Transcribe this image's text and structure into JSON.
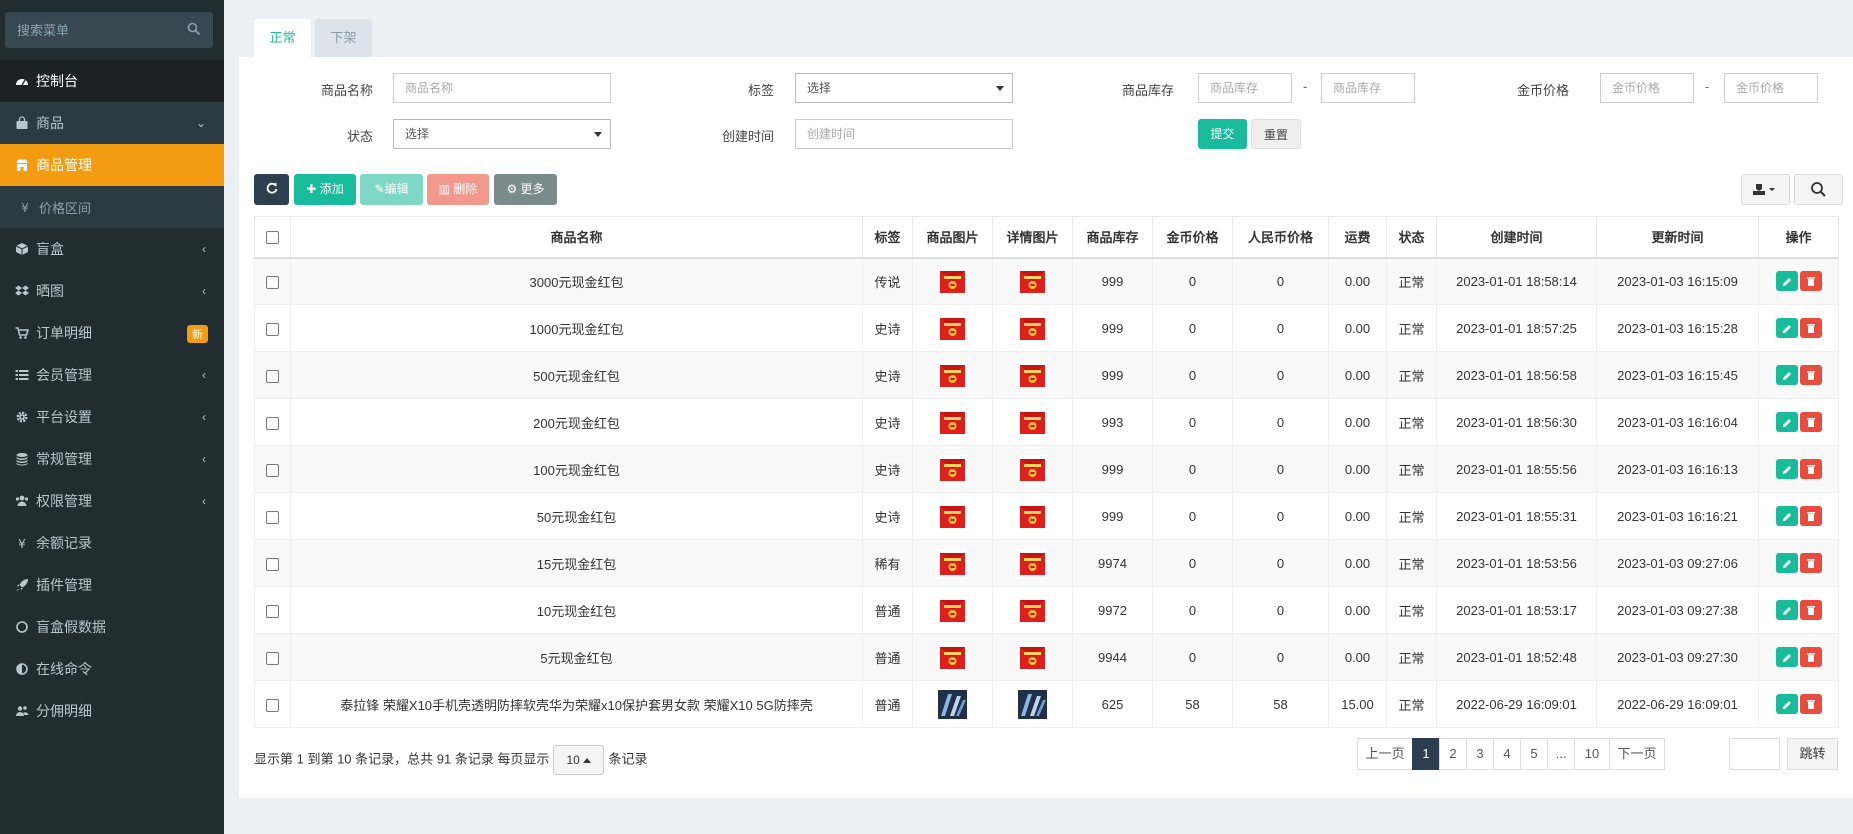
{
  "sidebar": {
    "search_placeholder": "搜索菜单",
    "items": [
      {
        "label": "控制台",
        "icon": "dashboard-icon"
      },
      {
        "label": "商品",
        "icon": "shopping-bag-icon"
      },
      {
        "label": "商品管理",
        "icon": "shop-icon"
      },
      {
        "label": "价格区间",
        "icon": "yen-icon"
      },
      {
        "label": "盲盒",
        "icon": "cube-icon"
      },
      {
        "label": "晒图",
        "icon": "dropbox-icon"
      },
      {
        "label": "订单明细",
        "icon": "cart-icon",
        "badge": "新"
      },
      {
        "label": "会员管理",
        "icon": "list-icon"
      },
      {
        "label": "平台设置",
        "icon": "cog-icon"
      },
      {
        "label": "常规管理",
        "icon": "database-icon"
      },
      {
        "label": "权限管理",
        "icon": "group-icon"
      },
      {
        "label": "余额记录",
        "icon": "yen-icon"
      },
      {
        "label": "插件管理",
        "icon": "rocket-icon"
      },
      {
        "label": "盲盒假数据",
        "icon": "circle-icon"
      },
      {
        "label": "在线命令",
        "icon": "adjust-icon"
      },
      {
        "label": "分佣明细",
        "icon": "users-icon"
      }
    ]
  },
  "tabs": [
    "正常",
    "下架"
  ],
  "filters": {
    "name_label": "商品名称",
    "name_placeholder": "商品名称",
    "tag_label": "标签",
    "tag_value": "选择",
    "stock_label": "商品库存",
    "stock_min_placeholder": "商品库存",
    "stock_max_placeholder": "商品库存",
    "price_label": "金币价格",
    "price_min_placeholder": "金币价格",
    "price_max_placeholder": "金币价格",
    "status_label": "状态",
    "status_value": "选择",
    "created_label": "创建时间",
    "created_placeholder": "创建时间",
    "dash": "-",
    "submit": "提交",
    "reset": "重置"
  },
  "toolbar": {
    "add": "添加",
    "edit": "编辑",
    "delete": "删除",
    "more": "更多"
  },
  "table": {
    "headers": [
      "商品名称",
      "标签",
      "商品图片",
      "详情图片",
      "商品库存",
      "金币价格",
      "人民币价格",
      "运费",
      "状态",
      "创建时间",
      "更新时间",
      "操作"
    ],
    "rows": [
      {
        "name": "3000元现金红包",
        "tag": "传说",
        "tag_type": "legend",
        "img": "red-envelope",
        "stock": "999",
        "coin": "0",
        "rmb": "0",
        "freight": "0.00",
        "status": "正常",
        "created": "2023-01-01 18:58:14",
        "updated": "2023-01-03 16:15:09"
      },
      {
        "name": "1000元现金红包",
        "tag": "史诗",
        "tag_type": "epic",
        "img": "red-envelope",
        "stock": "999",
        "coin": "0",
        "rmb": "0",
        "freight": "0.00",
        "status": "正常",
        "created": "2023-01-01 18:57:25",
        "updated": "2023-01-03 16:15:28"
      },
      {
        "name": "500元现金红包",
        "tag": "史诗",
        "tag_type": "epic",
        "img": "red-envelope",
        "stock": "999",
        "coin": "0",
        "rmb": "0",
        "freight": "0.00",
        "status": "正常",
        "created": "2023-01-01 18:56:58",
        "updated": "2023-01-03 16:15:45"
      },
      {
        "name": "200元现金红包",
        "tag": "史诗",
        "tag_type": "epic",
        "img": "red-envelope",
        "stock": "993",
        "coin": "0",
        "rmb": "0",
        "freight": "0.00",
        "status": "正常",
        "created": "2023-01-01 18:56:30",
        "updated": "2023-01-03 16:16:04"
      },
      {
        "name": "100元现金红包",
        "tag": "史诗",
        "tag_type": "epic",
        "img": "red-envelope",
        "stock": "999",
        "coin": "0",
        "rmb": "0",
        "freight": "0.00",
        "status": "正常",
        "created": "2023-01-01 18:55:56",
        "updated": "2023-01-03 16:16:13"
      },
      {
        "name": "50元现金红包",
        "tag": "史诗",
        "tag_type": "epic",
        "img": "red-envelope",
        "stock": "999",
        "coin": "0",
        "rmb": "0",
        "freight": "0.00",
        "status": "正常",
        "created": "2023-01-01 18:55:31",
        "updated": "2023-01-03 16:16:21"
      },
      {
        "name": "15元现金红包",
        "tag": "稀有",
        "tag_type": "rare",
        "img": "red-envelope",
        "stock": "9974",
        "coin": "0",
        "rmb": "0",
        "freight": "0.00",
        "status": "正常",
        "created": "2023-01-01 18:53:56",
        "updated": "2023-01-03 09:27:06"
      },
      {
        "name": "10元现金红包",
        "tag": "普通",
        "tag_type": "normal",
        "img": "red-envelope",
        "stock": "9972",
        "coin": "0",
        "rmb": "0",
        "freight": "0.00",
        "status": "正常",
        "created": "2023-01-01 18:53:17",
        "updated": "2023-01-03 09:27:38"
      },
      {
        "name": "5元现金红包",
        "tag": "普通",
        "tag_type": "normal",
        "img": "red-envelope",
        "stock": "9944",
        "coin": "0",
        "rmb": "0",
        "freight": "0.00",
        "status": "正常",
        "created": "2023-01-01 18:52:48",
        "updated": "2023-01-03 09:27:30"
      },
      {
        "name": "泰拉锋 荣耀X10手机壳透明防摔软壳华为荣耀x10保护套男女款 荣耀X10 5G防摔壳",
        "tag": "普通",
        "tag_type": "normal",
        "img": "phone-case",
        "stock": "625",
        "coin": "58",
        "rmb": "58",
        "freight": "15.00",
        "status": "正常",
        "created": "2022-06-29 16:09:01",
        "updated": "2022-06-29 16:09:01"
      }
    ]
  },
  "footer": {
    "info_prefix": "显示第 1 到第 10 条记录，总共 91 条记录 每页显示",
    "page_size": "10",
    "info_suffix": "条记录",
    "pages": [
      "上一页",
      "1",
      "2",
      "3",
      "4",
      "5",
      "...",
      "10",
      "下一页"
    ],
    "current_page": "1",
    "jump": "跳转"
  },
  "colors": {
    "primary": "#18bc9c",
    "sidebar_bg": "#222d32",
    "active": "#f39c12",
    "danger": "#e74c3c",
    "dark": "#2c3e50"
  }
}
